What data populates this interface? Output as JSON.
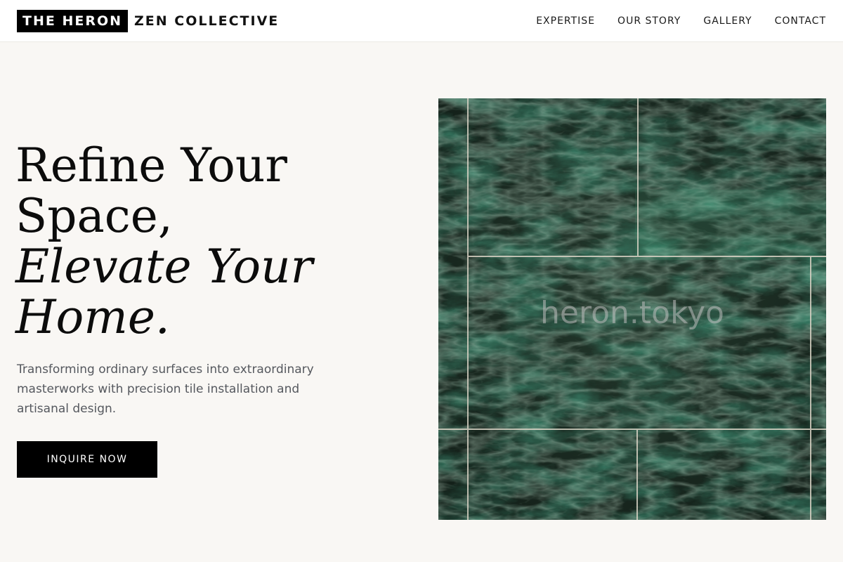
{
  "header": {
    "logo": {
      "boxed": "THE HERON",
      "rest": "ZEN COLLECTIVE"
    },
    "nav": [
      {
        "label": "EXPERTISE"
      },
      {
        "label": "OUR STORY"
      },
      {
        "label": "GALLERY"
      },
      {
        "label": "CONTACT"
      }
    ]
  },
  "hero": {
    "title_lines": [
      "Refine Your",
      "Space,"
    ],
    "title_italic_lines": [
      "Elevate Your",
      "Home."
    ],
    "subtitle": "Transforming ordinary surfaces into extraordinary masterworks with precision tile installation and artisanal design.",
    "cta_label": "INQUIRE NOW",
    "image": {
      "watermark": "heron.tokyo",
      "description_icon": "green-marble-tiles-image"
    }
  },
  "colors": {
    "background": "#f9f7f4",
    "header_bg": "#ffffff",
    "accent": "#000000",
    "text": "#0c0c0c",
    "subtext": "#55585e",
    "marble": "#1d3328"
  }
}
